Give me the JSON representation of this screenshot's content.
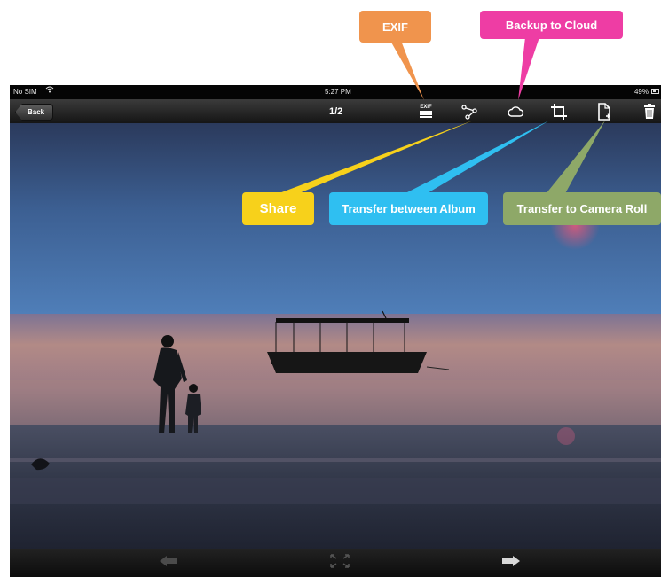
{
  "status_bar": {
    "carrier": "No SIM",
    "time": "5:27 PM",
    "battery": "49%"
  },
  "toolbar": {
    "back_label": "Back",
    "counter": "1/2",
    "exif_label": "EXIF"
  },
  "callouts": {
    "exif": "EXIF",
    "backup": "Backup to Cloud",
    "share": "Share",
    "transfer_album": "Transfer between Album",
    "camera_roll": "Transfer to Camera Roll"
  },
  "icons": {
    "toolbar": [
      "exif-icon",
      "share-icon",
      "cloud-icon",
      "crop-icon",
      "export-icon",
      "trash-icon"
    ],
    "bottom_bar": [
      "arrow-left-icon",
      "fullscreen-icon",
      "arrow-right-icon"
    ]
  },
  "colors": {
    "exif_callout": "#f0944d",
    "backup_callout": "#ee3da4",
    "share_callout": "#f7d11b",
    "transfer_album_callout": "#2fbff1",
    "camera_roll_callout": "#8ea868"
  }
}
